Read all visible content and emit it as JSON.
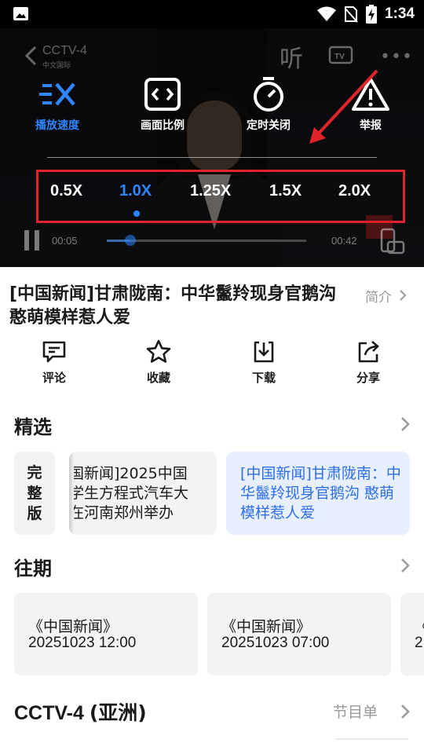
{
  "status_bar": {
    "time": "1:34",
    "icons": [
      "image-icon",
      "wifi-icon",
      "no-sim-icon",
      "battery-charging-icon"
    ]
  },
  "player": {
    "channel_label": "CCTV-4",
    "channel_sublabel": "中文国际",
    "listen_label": "听",
    "menu": [
      {
        "label": "播放速度",
        "icon": "speed-icon",
        "active": true
      },
      {
        "label": "画面比例",
        "icon": "aspect-ratio-icon",
        "active": false
      },
      {
        "label": "定时关闭",
        "icon": "timer-icon",
        "active": false
      },
      {
        "label": "举报",
        "icon": "report-warning-icon",
        "active": false
      }
    ],
    "speeds": [
      "0.5X",
      "1.0X",
      "1.25X",
      "1.5X",
      "2.0X"
    ],
    "selected_speed": "1.0X",
    "current_time": "00:05",
    "total_time": "00:42",
    "progress_fraction": 0.12,
    "colors": {
      "accent": "#2f86ff",
      "highlight_box": "#e0242b",
      "annotation_arrow": "#e0242b"
    }
  },
  "video": {
    "title": "[中国新闻]甘肃陇南：中华鬣羚现身官鹅沟 憨萌模样惹人爱",
    "intro_label": "简介"
  },
  "actions": [
    {
      "label": "评论",
      "icon": "comment-icon"
    },
    {
      "label": "收藏",
      "icon": "star-icon"
    },
    {
      "label": "下载",
      "icon": "download-icon"
    },
    {
      "label": "分享",
      "icon": "share-icon"
    }
  ],
  "featured": {
    "title": "精选",
    "tag": "完\n整\n版",
    "cards": [
      {
        "lines": [
          "国新闻]2025中国",
          "学生方程式汽车大",
          "在河南郑州举办"
        ]
      },
      {
        "lines": [
          "[中国新闻]甘肃陇南：中华鬣羚现身官鹅沟 憨萌模样惹人爱"
        ],
        "active": true
      }
    ]
  },
  "past": {
    "title": "往期",
    "cards": [
      {
        "name": "《中国新闻》",
        "datetime": "20251023 12:00"
      },
      {
        "name": "《中国新闻》",
        "datetime": "20251023 07:00"
      },
      {
        "name": "《",
        "datetime": "2"
      }
    ]
  },
  "channel": {
    "name_latin": "CCTV-4 ",
    "name_cn": "(亚洲)",
    "schedule_label": "节目单"
  }
}
